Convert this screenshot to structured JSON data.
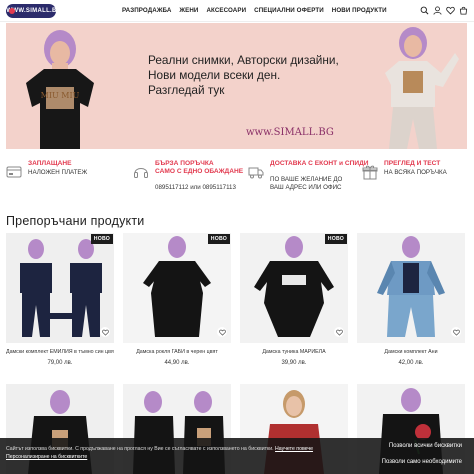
{
  "header": {
    "logo_text": "WWW.SIMALL.BG",
    "nav": [
      "РАЗПРОДАЖБА",
      "ЖЕНИ",
      "АКСЕСОАРИ",
      "СПЕЦИАЛНИ ОФЕРТИ",
      "НОВИ ПРОДУКТИ"
    ],
    "icons": [
      "search-icon",
      "user-icon",
      "heart-icon",
      "cart-icon"
    ]
  },
  "hero": {
    "line1": "Реални снимки, Авторски дизайни,",
    "line2": "Нови модели всеки ден.",
    "line3": "Разгледай тук",
    "site": "www.SIMALL.BG",
    "shirt_text": "MIU MIU"
  },
  "features": [
    {
      "icon": "card-payment-icon",
      "title": "ЗАПЛАЩАНЕ",
      "title2": "",
      "desc": "НАЛОЖЕН ПЛАТЕЖ",
      "desc2": ""
    },
    {
      "icon": "headset-icon",
      "title": "БЪРЗА ПОРЪЧКА",
      "title2": "САМО С ЕДНО ОБАЖДАНЕ",
      "desc": "0895117112 или 0895117113",
      "desc2": ""
    },
    {
      "icon": "truck-icon",
      "title": "ДОСТАВКА С ЕКОНТ и СПИДИ",
      "title2": "",
      "desc": "ПО ВАШЕ ЖЕЛАНИЕ ДО",
      "desc2": "ВАШ АДРЕС ИЛИ ОФИС"
    },
    {
      "icon": "gift-icon",
      "title": "ПРЕГЛЕД И ТЕСТ",
      "title2": "",
      "desc": "НА ВСЯКА ПОРЪЧКА",
      "desc2": ""
    }
  ],
  "section_title": "Препоръчани продукти",
  "products": [
    {
      "name": "Дамски комплект ЕМИЛИЯ в тъмно син цвят",
      "price": "79,00 лв.",
      "badge": "НОВО"
    },
    {
      "name": "Дамска рокля ГАБИ в черен цвят",
      "price": "44,90 лв.",
      "badge": "НОВО"
    },
    {
      "name": "Дамска туника МАРИЕЛА",
      "price": "39,90 лв.",
      "badge": "НОВО"
    },
    {
      "name": "Дамски комплект Ани",
      "price": "42,00 лв.",
      "badge": ""
    }
  ],
  "cookie": {
    "text": "Сайтът използва бисквитки. С продължаване на проглася ну Вие се съгласявате с използването на бисквитки.",
    "link": "Научете повече",
    "more": "Персонализиране на бисквитките",
    "allow_all": "Позволи всички бисквитки",
    "allow_necessary": "Позволи само необходимите"
  },
  "colors": {
    "accent": "#e23a4f",
    "hero_bg": "#f3d2cb",
    "site_text": "#8a2f67",
    "dark": "#1c1c1c"
  }
}
